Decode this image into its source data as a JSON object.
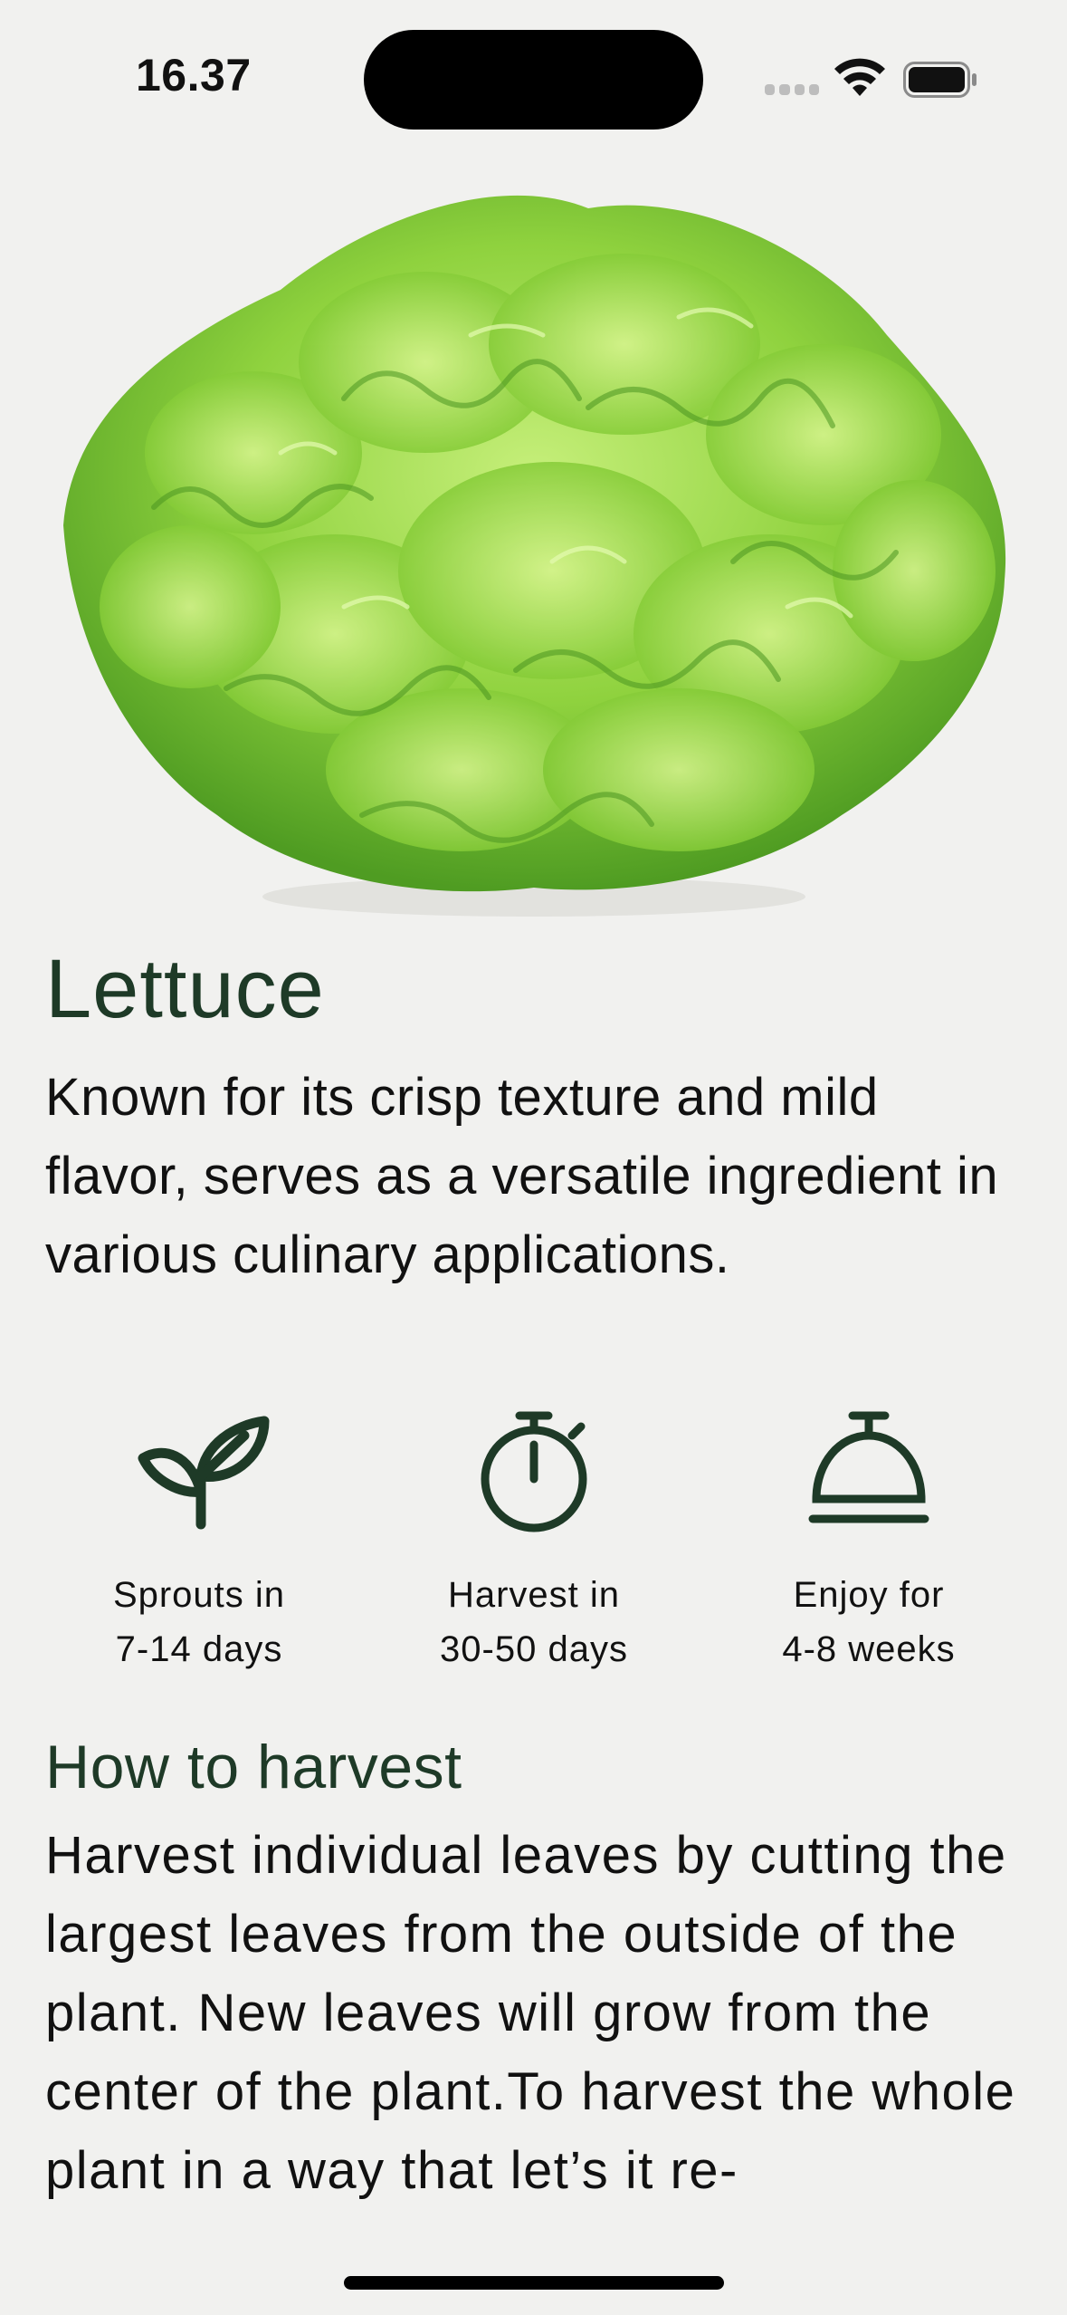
{
  "status_bar": {
    "time": "16.37"
  },
  "plant": {
    "name": "Lettuce",
    "description": "Known for its crisp texture and mild flavor, serves as a versatile ingredient in various culinary applications.",
    "image_icon": "lettuce-image"
  },
  "stats": [
    {
      "icon": "sprout-icon",
      "line1": "Sprouts in",
      "line2": "7-14 days"
    },
    {
      "icon": "stopwatch-icon",
      "line1": "Harvest in",
      "line2": "30-50 days"
    },
    {
      "icon": "cloche-icon",
      "line1": "Enjoy for",
      "line2": "4-8 weeks"
    }
  ],
  "harvest": {
    "title": "How to harvest",
    "body": "Harvest individual leaves by cutting the largest leaves from the outside of the plant. New leaves will grow from the center of the plant.To harvest the whole plant in a way that let’s it re-"
  },
  "colors": {
    "background": "#f1f1ef",
    "accent_green": "#1e3a27",
    "lettuce_light": "#a6e05a",
    "lettuce_dark": "#5fae2a"
  }
}
